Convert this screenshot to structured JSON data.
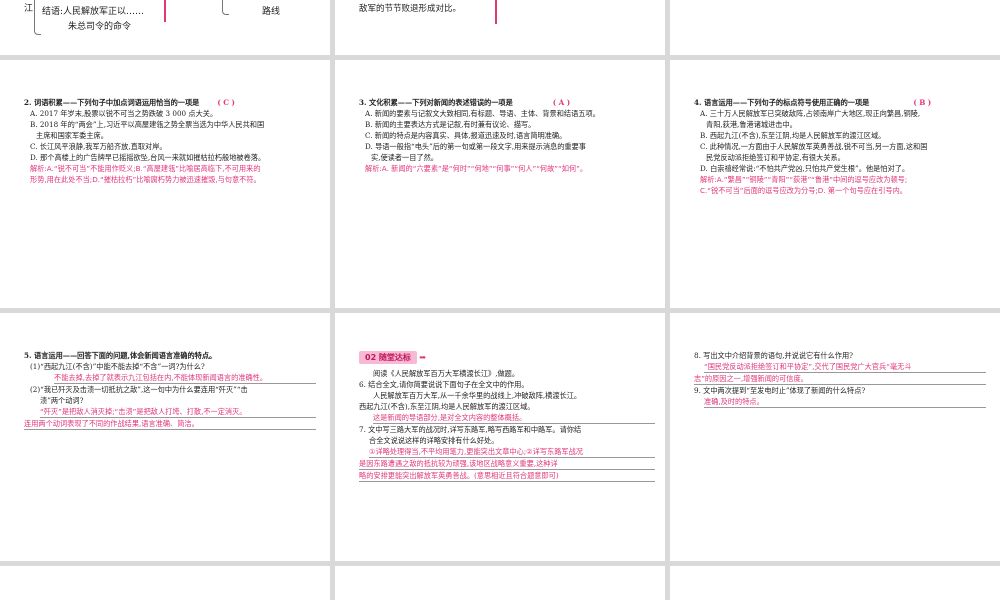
{
  "top_left": {
    "side": "江",
    "line1": "结语:人民解放军正以……",
    "line2": "朱总司令的命令",
    "right": "路线"
  },
  "top_mid": {
    "line1": "敌军的节节败退形成对比。"
  },
  "q2": {
    "stem": "2. 词语积累——下列句子中加点词语运用恰当的一项是",
    "answer": "( C )",
    "options": [
      "A. 2017 年岁末,股票以锐不可当之势跌破 3 000 点大关。",
      "B. 2018 年的“两会”上,习近平以高屋建瓴之势全票当选为中华人民共和国",
      "主席和国家军委主席。",
      "C. 长江风平浪静,我军万船齐放,直取对岸。",
      "D. 那个高楼上的广告牌早已摇摇欲坠,台风一来就如摧枯拉朽般地被卷落。"
    ],
    "analysis": [
      "解析:A.“锐不可当”不能用作贬义;B.“高屋建瓴”比喻居高临下,不可用来的",
      "形势,用在此处不当;D.“摧枯拉朽”比喻腐朽势力被迅速摧毁,与句意不符。"
    ]
  },
  "q3": {
    "stem": "3. 文化积累——下列对新闻的表述错误的一项是",
    "answer": "( A )",
    "options": [
      "A. 新闻的要素与记叙文大致相同,有标题、导语、主体、背景和结语五项。",
      "B. 新闻的主要表达方式是记叙,有时兼有议论、描写。",
      "C. 新闻的特点是内容真实、具体,报道迅速及时,语言简明准确。",
      "D. 导语一般指“电头”后的第一句或第一段文字,用来提示消息的重要事",
      "实,使读者一目了然。"
    ],
    "analysis": [
      "解析:A. 新闻的“六要素”是“何时”“何地”“何事”“何人”“何故”“如何”。"
    ]
  },
  "q4": {
    "stem": "4. 语言运用——下列句子的标点符号使用正确的一项是",
    "answer": "( B )",
    "options": [
      "A. 三十万人民解放军已突破敌阵,占领南岸广大地区,现正向繁昌,铜陵,",
      "青阳,荻港,鲁港诸城进击中。",
      "B. 西起九江(不含),东至江阴,均是人民解放军的渡江区域。",
      "C. 此种情况,一方面由于人民解放军英勇善战,锐不可当,另一方面,这和国",
      "民党反动派拒绝签订和平协定,有很大关系。",
      "D. 白崇禧经常说:“不怕共产党凶,只怕共产党生根”。他是怕对了。"
    ],
    "analysis": [
      "解析:A.“繁昌”“铜陵”“青阳”“荻港”“鲁港”中间的逗号应改为顿号;",
      "C.“锐不可当”后面的逗号应改为分号;D. 第一个句号应在引号内。"
    ]
  },
  "q5": {
    "stem": "5. 语言运用——回答下面的问题,体会新闻语言准确的特点。",
    "sub1": "(1)“西起九江(不含)”中能不能去掉“不含”一词?为什么?",
    "ans1": "不能去掉,去掉了就表示九江包括在内,不能体现新闻语言的准确性。",
    "sub2a": "(2)“我已歼灭及击溃一切抵抗之敌”,这一句中为什么要连用“歼灭”“击",
    "sub2b": "溃”两个动词?",
    "ans2a": "“歼灭”是把敌人消灭掉;“击溃”是把敌人打垮、打散,不一定消灭。",
    "ans2b": "连用两个动词表现了不同的作战结果,语言准确、简洁。"
  },
  "mid": {
    "badge": "02 随堂达标",
    "intro": "阅读《人民解放军百万大军横渡长江》,做题。",
    "q6": "6. 结合全文,请你简要说说下面句子在全文中的作用。",
    "passage1": "人民解放军百万大军,从一千余华里的战线上,冲破敌阵,横渡长江。",
    "passage2": "西起九江(不含),东至江阴,均是人民解放军的渡江区域。",
    "ans6": "这是新闻的导语部分,是对全文内容的整体概括。",
    "q7a": "7. 文中写三路大军的战况时,详写东路军,略写西路军和中路军。请你结",
    "q7b": "合全文说说这样的详略安排有什么好处。",
    "ans7a": "①详略处理得当,不平均用笔力,更能突出文章中心;②详写东路军战况",
    "ans7b": "是因东路遭遇之敌的抵抗较为顽强,该地区战略意义重要,这种详",
    "ans7c": "略的安排更能突出解放军英勇善战。(意思相近且符合题意即可)"
  },
  "right": {
    "q8": "8. 写出文中介绍背景的语句,并说说它有什么作用?",
    "ans8a": "“国民党反动派拒绝签订和平协定”,交代了国民党广大官兵“毫无斗",
    "ans8b": "志”的原因之一,增强新闻的可信度。",
    "q9": "9. 文中两次提到“至发电时止”体现了新闻的什么特点?",
    "ans9": "准确,及时的特点。"
  }
}
